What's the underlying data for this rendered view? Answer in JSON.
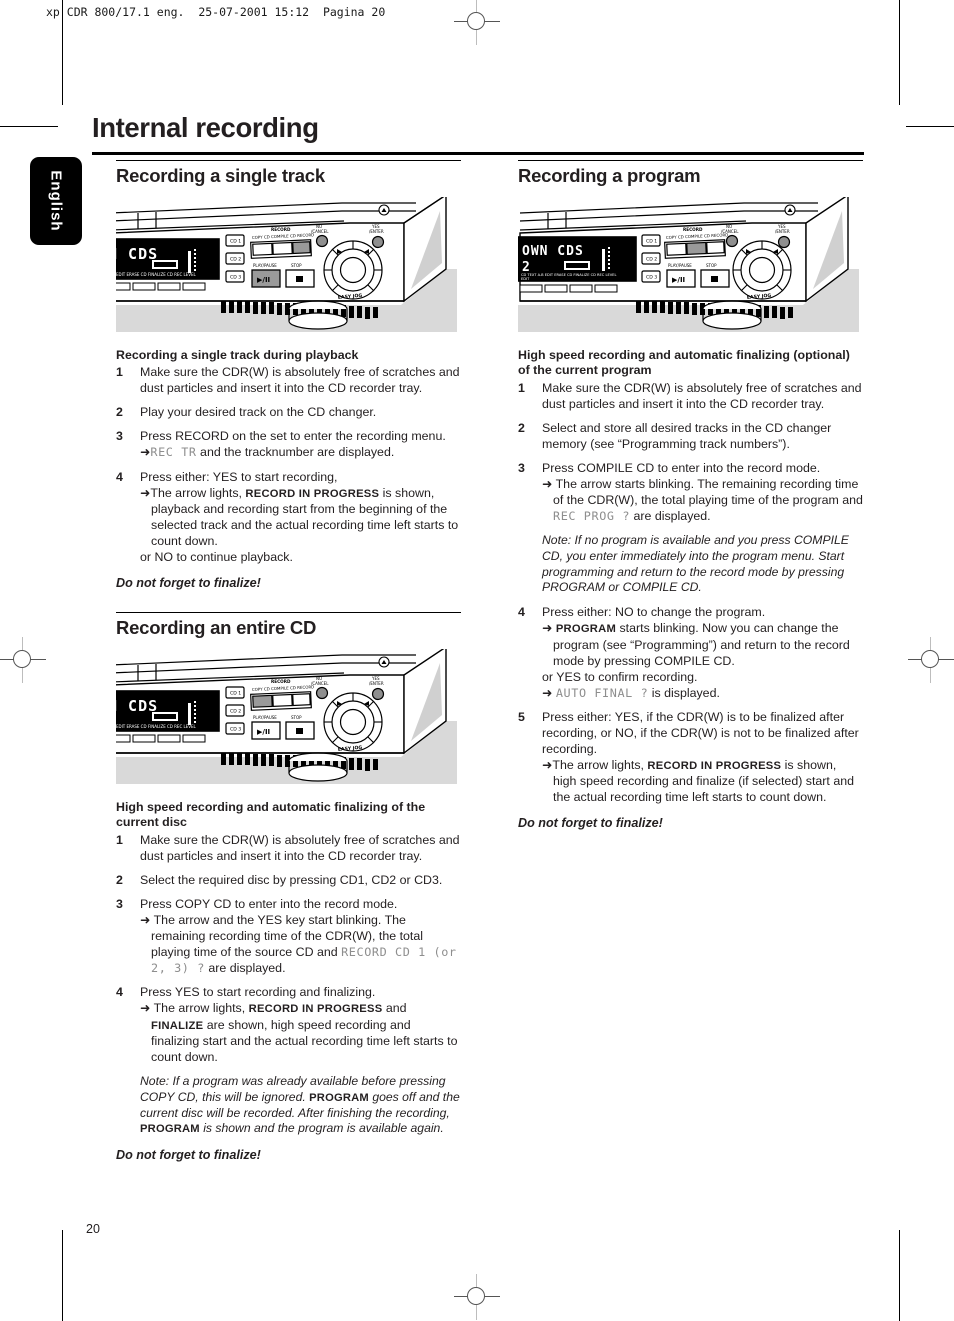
{
  "print_slug": "xp CDR 800/17.1 eng.  25-07-2001 15:12  Pagina 20",
  "language_tab": "English",
  "page_title": "Internal recording",
  "page_number": "20",
  "left_column": {
    "section1": {
      "heading": "Recording a single track",
      "device_display_line1": "N CDS",
      "subhead": "Recording a single track during playback",
      "steps": [
        {
          "num": "1",
          "lines": [
            "Make sure the CDR(W) is absolutely free of scratches and dust",
            "particles and insert it into the CD recorder tray."
          ]
        },
        {
          "num": "2",
          "lines": [
            "Play your desired track on the CD changer."
          ]
        },
        {
          "num": "3",
          "lines": [
            "Press RECORD on the set to enter the recording menu."
          ],
          "arrow_lcd": "REC  TR",
          "arrow_tail": " and the tracknumber are displayed."
        },
        {
          "num": "4",
          "lines": [
            "Press either:",
            "YES to start recording,"
          ],
          "arrow_pre": "The arrow lights, ",
          "arrow_sc": "RECORD IN PROGRESS",
          "arrow_post": " is shown, playback and recording start from the beginning of the selected track and the actual recording time left starts to count down.",
          "after": [
            "or",
            "NO to continue playback."
          ]
        }
      ],
      "finalize": "Do not forget to finalize!"
    },
    "section2": {
      "heading": "Recording an entire CD",
      "device_display_line1": "N CDS",
      "subhead_line1": "High speed recording and automatic finalizing of the",
      "subhead_line2": "current disc",
      "steps": [
        {
          "num": "1",
          "lines": [
            "Make sure the CDR(W) is absolutely free of scratches and dust",
            "particles and insert it into the CD recorder tray."
          ]
        },
        {
          "num": "2",
          "lines": [
            "Select the required disc by pressing CD1, CD2 or CD3."
          ]
        },
        {
          "num": "3",
          "lines": [
            "Press COPY CD to enter into the record mode."
          ],
          "arrow_pre": "The arrow and the YES key start blinking. The remaining recording time of the CDR(W), the total playing time of the source CD and ",
          "arrow_lcd": "RECORD CD 1 (or 2, 3) ?",
          "arrow_post": " are displayed."
        },
        {
          "num": "4",
          "lines": [
            "Press YES to start recording and finalizing."
          ],
          "arrow_pre": "The arrow lights, ",
          "arrow_sc": "RECORD IN PROGRESS",
          "arrow_mid": " and ",
          "arrow_sc2": "FINALIZE",
          "arrow_post": " are shown, high speed recording and finalizing start and the actual recording time left starts to count down."
        }
      ],
      "note_a": "Note:  If a program was already available before pressing COPY CD, this will be ignored. ",
      "note_b": "PROGRAM",
      "note_c": " goes off and the current disc will be recorded. After finishing the recording, ",
      "note_d": "PROGRAM",
      "note_e": " is shown and the program is available again.",
      "finalize": "Do not forget to finalize!"
    }
  },
  "right_column": {
    "section1": {
      "heading": "Recording a program",
      "device_display_line1": "OWN CDS",
      "device_display_line2": "2",
      "subhead_line1": "High speed recording and automatic finalizing",
      "subhead_line2": "(optional) of the current program",
      "steps": [
        {
          "num": "1",
          "lines": [
            "Make sure the CDR(W) is absolutely free of scratches and dust",
            "particles and insert it into the CD recorder tray."
          ]
        },
        {
          "num": "2",
          "lines": [
            "Select and store all desired tracks in the CD changer memory",
            "(see “Programming track numbers”)."
          ]
        },
        {
          "num": "3",
          "lines": [
            "Press COMPILE CD to enter into the record mode."
          ],
          "arrow_pre": "The arrow starts blinking. The remaining recording time of the CDR(W), the total playing time of the program and ",
          "arrow_lcd": "REC PROG ?",
          "arrow_post": " are displayed."
        },
        {
          "num": "4",
          "lines": [
            "Press either:",
            "NO to change the program."
          ],
          "arrow_sc": "PROGRAM",
          "arrow_post": " starts blinking. Now you can change the program (see “Programming”) and return to the record mode by pressing COMPILE CD.",
          "after": [
            "or",
            "YES to confirm recording."
          ],
          "arrow2_lcd": "AUTO FINAL ?",
          "arrow2_post": " is displayed."
        },
        {
          "num": "5",
          "lines": [
            "Press either:",
            "YES, if the CDR(W) is to be finalized after recording,",
            "or",
            "NO, if the CDR(W) is not to be finalized after recording."
          ],
          "arrow_pre": "The arrow lights, ",
          "arrow_sc": "RECORD IN PROGRESS",
          "arrow_post": " is shown, high speed recording and finalize (if selected) start and the actual recording time left starts to count down."
        }
      ],
      "note_a": "Note: If no program is available and you press COMPILE CD, you enter immediately into the program menu. Start programming and return to the record mode by pressing PROGRAM or COMPILE CD.",
      "finalize": "Do not forget to finalize!"
    }
  },
  "device_labels": {
    "cd1": "CD 1",
    "cd2": "CD 2",
    "cd3": "CD 3",
    "record_group": "RECORD",
    "copy_cd": "COPY CD",
    "compile_cd": "COMPILE CD",
    "record": "RECORD",
    "no_cancel_1": "NO",
    "no_cancel_2": "/CANCEL",
    "yes_enter_1": "YES",
    "yes_enter_2": "/ENTER",
    "play_pause": "PLAY/PAUSE",
    "stop": "STOP",
    "jog": "EASY JOG",
    "play_glyph": "▶/II",
    "stop_glyph": "■",
    "eject_glyph": "▲",
    "display_status": "A-B EDIT   ERASE CD   FINALIZE CD   REC LEVEL",
    "display_status_right": "CD TEXT EDIT    A-B EDIT   ERASE CD   FINALIZE CD   REC LEVEL"
  }
}
